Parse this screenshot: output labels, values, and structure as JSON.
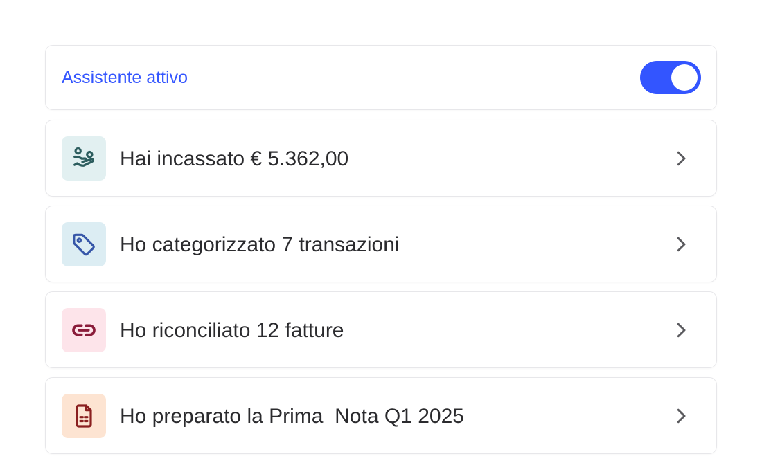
{
  "assistant": {
    "label": "Assistente attivo",
    "enabled": true,
    "accent_color": "#3355ff"
  },
  "items": [
    {
      "label": "Hai incassato € 5.362,00",
      "icon": "hand-money-icon",
      "icon_bg": "#e2f0f1",
      "icon_color": "#2c5d5e"
    },
    {
      "label": "Ho categorizzato 7 transazioni",
      "icon": "tag-icon",
      "icon_bg": "#dcedf3",
      "icon_color": "#3656a8"
    },
    {
      "label": "Ho riconciliato 12 fatture",
      "icon": "link-icon",
      "icon_bg": "#fde4ea",
      "icon_color": "#8a1c3a"
    },
    {
      "label": "Ho preparato la Prima  Nota Q1 2025",
      "icon": "document-icon",
      "icon_bg": "#fde4d2",
      "icon_color": "#8a1f1f"
    }
  ]
}
